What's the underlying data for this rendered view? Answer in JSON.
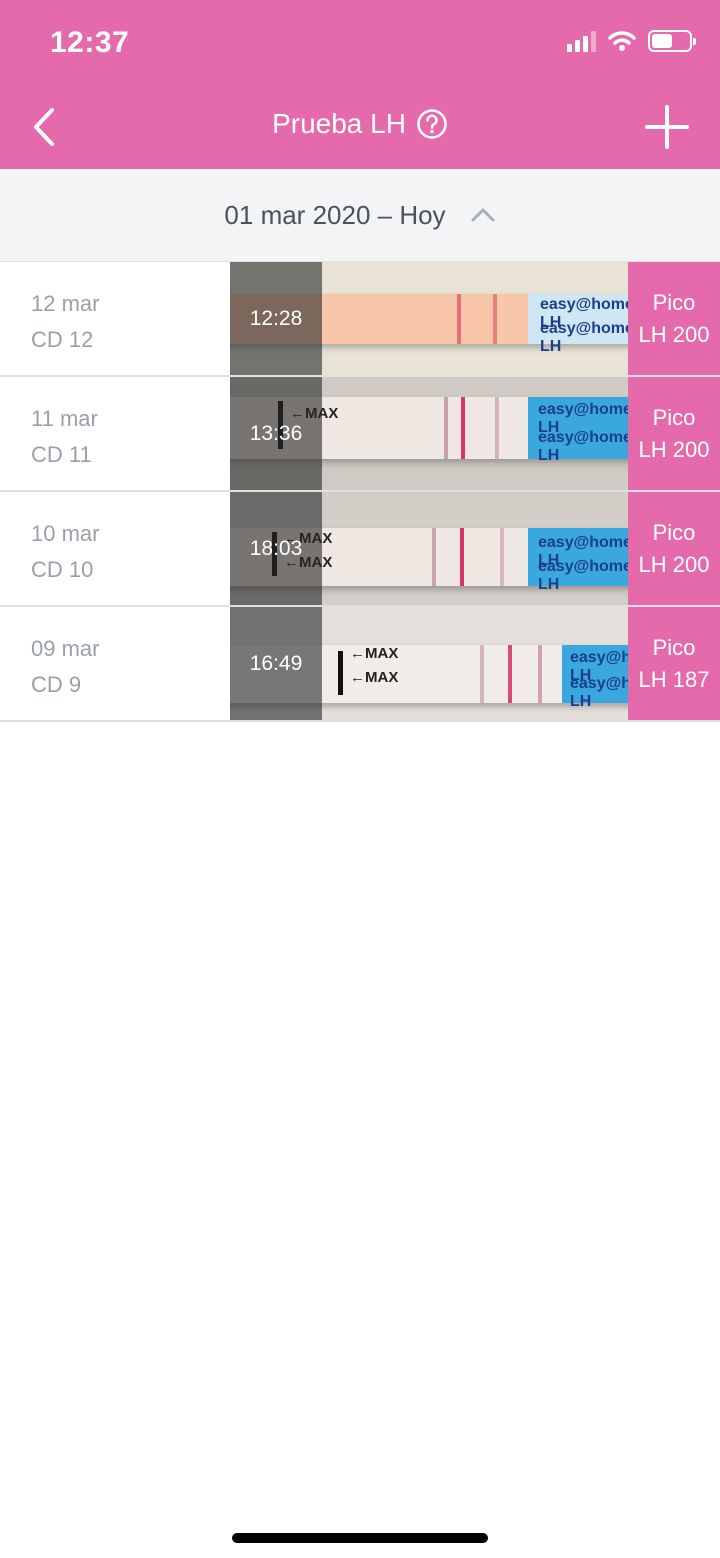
{
  "status_bar": {
    "time": "12:37",
    "battery_level": 0.55
  },
  "nav": {
    "title": "Prueba LH",
    "back_icon": "chevron-left-icon",
    "help_icon": "question-circle-icon",
    "add_icon": "plus-icon"
  },
  "date_bar": {
    "range": "01 mar 2020 – Hoy",
    "toggle_icon": "chevron-up-icon"
  },
  "tests": [
    {
      "date": "12 mar",
      "cd": "CD 12",
      "time": "12:28",
      "result_label": "Pico",
      "result_value": "LH 200"
    },
    {
      "date": "11 mar",
      "cd": "CD 11",
      "time": "13:36",
      "result_label": "Pico",
      "result_value": "LH 200"
    },
    {
      "date": "10 mar",
      "cd": "CD 10",
      "time": "18:03",
      "result_label": "Pico",
      "result_value": "LH 200"
    },
    {
      "date": "09 mar",
      "cd": "CD 9",
      "time": "16:49",
      "result_label": "Pico",
      "result_value": "LH 187"
    }
  ],
  "colors": {
    "brand_pink": "#e46aab",
    "date_bar_bg": "#f3f4f6",
    "muted_text": "#9aa0a8"
  }
}
